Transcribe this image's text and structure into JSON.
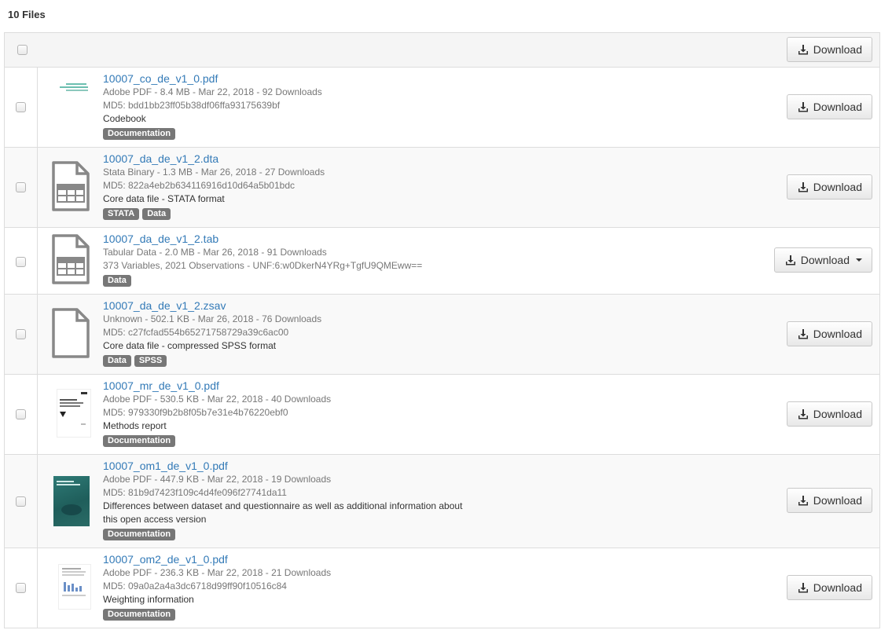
{
  "header": {
    "files_count": "10 Files",
    "download_label": "Download"
  },
  "files": [
    {
      "name": "10007_co_de_v1_0.pdf",
      "meta": "Adobe PDF - 8.4 MB - Mar 22, 2018 - 92 Downloads",
      "detail": "MD5: bdd1bb23ff05b38df06ffa93175639bf",
      "description": "Codebook",
      "tags": [
        "Documentation"
      ],
      "download_label": "Download",
      "thumb": "pdf-codebook-thumbnail"
    },
    {
      "name": "10007_da_de_v1_2.dta",
      "meta": "Stata Binary - 1.3 MB - Mar 26, 2018 - 27 Downloads",
      "detail": "MD5: 822a4eb2b634116916d10d64a5b01bdc",
      "description": "Core data file - STATA format",
      "tags": [
        "STATA",
        "Data"
      ],
      "download_label": "Download",
      "thumb": "tabular-file-icon"
    },
    {
      "name": "10007_da_de_v1_2.tab",
      "meta": "Tabular Data - 2.0 MB - Mar 26, 2018 - 91 Downloads",
      "detail": "373 Variables, 2021 Observations - UNF:6:w0DkerN4YRg+TgfU9QMEww==",
      "description": "",
      "tags": [
        "Data"
      ],
      "download_label": "Download",
      "thumb": "tabular-file-icon"
    },
    {
      "name": "10007_da_de_v1_2.zsav",
      "meta": "Unknown - 502.1 KB - Mar 26, 2018 - 76 Downloads",
      "detail": "MD5: c27fcfad554b65271758729a39c6ac00",
      "description": "Core data file - compressed SPSS format",
      "tags": [
        "Data",
        "SPSS"
      ],
      "download_label": "Download",
      "thumb": "blank-file-icon"
    },
    {
      "name": "10007_mr_de_v1_0.pdf",
      "meta": "Adobe PDF - 530.5 KB - Mar 22, 2018 - 40 Downloads",
      "detail": "MD5: 979330f9b2b8f05b7e31e4b76220ebf0",
      "description": "Methods report",
      "tags": [
        "Documentation"
      ],
      "download_label": "Download",
      "thumb": "pdf-report-thumbnail"
    },
    {
      "name": "10007_om1_de_v1_0.pdf",
      "meta": "Adobe PDF - 447.9 KB - Mar 22, 2018 - 19 Downloads",
      "detail": "MD5: 81b9d7423f109c4d4fe096f27741da11",
      "description": "Differences between dataset and questionnaire as well as additional information about",
      "description2": "this open access version",
      "tags": [
        "Documentation"
      ],
      "download_label": "Download",
      "thumb": "pdf-teal-cover-thumbnail"
    },
    {
      "name": "10007_om2_de_v1_0.pdf",
      "meta": "Adobe PDF - 236.3 KB - Mar 22, 2018 - 21 Downloads",
      "detail": "MD5: 09a0a2a4a3dc6718d99ff90f10516c84",
      "description": "Weighting information",
      "tags": [
        "Documentation"
      ],
      "download_label": "Download",
      "thumb": "pdf-chart-thumbnail"
    }
  ]
}
